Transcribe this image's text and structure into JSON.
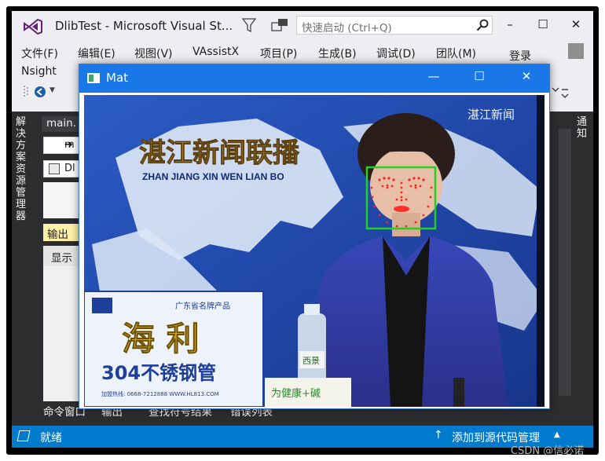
{
  "vs": {
    "title": "DlibTest - Microsoft Visual St...",
    "quick_launch_placeholder": "快速启动 (Ctrl+Q)",
    "window_controls": {
      "minimize": "–",
      "maximize": "☐",
      "close": "✕"
    },
    "menu": [
      "文件(F)",
      "编辑(E)",
      "视图(V)",
      "VAssistX",
      "项目(P)",
      "生成(B)",
      "调试(D)",
      "团队(M)"
    ],
    "menu_row2": "Nsight",
    "login": "登录",
    "left_tab": "解决方案资源管理器",
    "right_tab": "通知",
    "doc_tab": "main.",
    "nav_items": [
      "m",
      "Dl"
    ],
    "output_tab": "输出",
    "output_show_label": "显示",
    "bottom_tabs": [
      "命令窗口",
      "输出",
      "查找符号结果",
      "错误列表"
    ],
    "status_left": "就绪",
    "status_right": "添加到源代码管理",
    "accent": "#007acc"
  },
  "mat_window": {
    "title": "Mat",
    "controls": {
      "minimize": "—",
      "maximize": "☐",
      "close": "✕"
    },
    "frame": {
      "headline_cn": "湛江新闻联播",
      "headline_pinyin": "ZHAN JIANG XIN WEN LIAN BO",
      "logo_text": "湛江新闻",
      "ad_top": "广东省名牌产品",
      "ad_brand": "海 利",
      "ad_product": "304不锈钢管",
      "ad_footer": "加盟热线: 0668-7212888  WWW.HL813.COM",
      "bottle_label": "西景",
      "bottle_tag": "为健康+碱",
      "face_box_color": "#22d022",
      "landmark_color": "#ff2020"
    }
  },
  "watermark": "CSDN @信必诺"
}
